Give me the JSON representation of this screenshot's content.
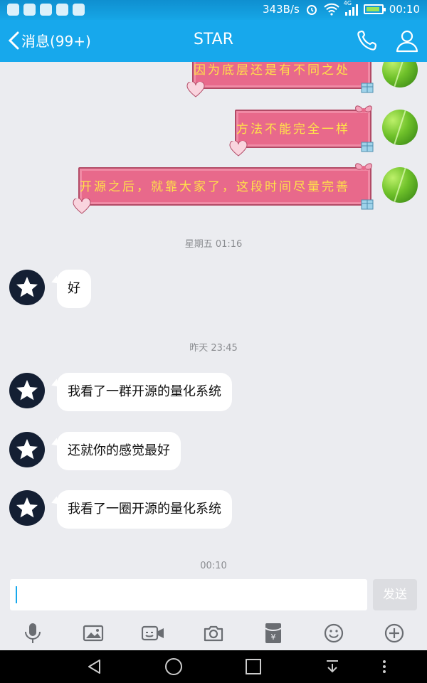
{
  "status_bar": {
    "network_speed": "343B/s",
    "signal_label": "4G",
    "time": "00:10"
  },
  "header": {
    "back_label": "消息(99+)",
    "title": "STAR",
    "accent_color": "#17a8ec"
  },
  "messages_outgoing": [
    {
      "text": "因为底层还是有不同之处"
    },
    {
      "text": "方法不能完全一样"
    },
    {
      "text": "开源之后，就靠大家了，这段时间尽量完善"
    }
  ],
  "timestamps": [
    "星期五 01:16",
    "昨天 23:45",
    "00:10"
  ],
  "messages_incoming": [
    {
      "text": "好"
    },
    {
      "text": "我看了一群开源的量化系统"
    },
    {
      "text": "还就你的感觉最好"
    },
    {
      "text": "我看了一圈开源的量化系统"
    }
  ],
  "input": {
    "value": "",
    "send_label": "发送"
  },
  "toolbar_icons": [
    "microphone-icon",
    "image-icon",
    "video-icon",
    "camera-icon",
    "red-packet-icon",
    "emoji-icon",
    "plus-icon"
  ]
}
